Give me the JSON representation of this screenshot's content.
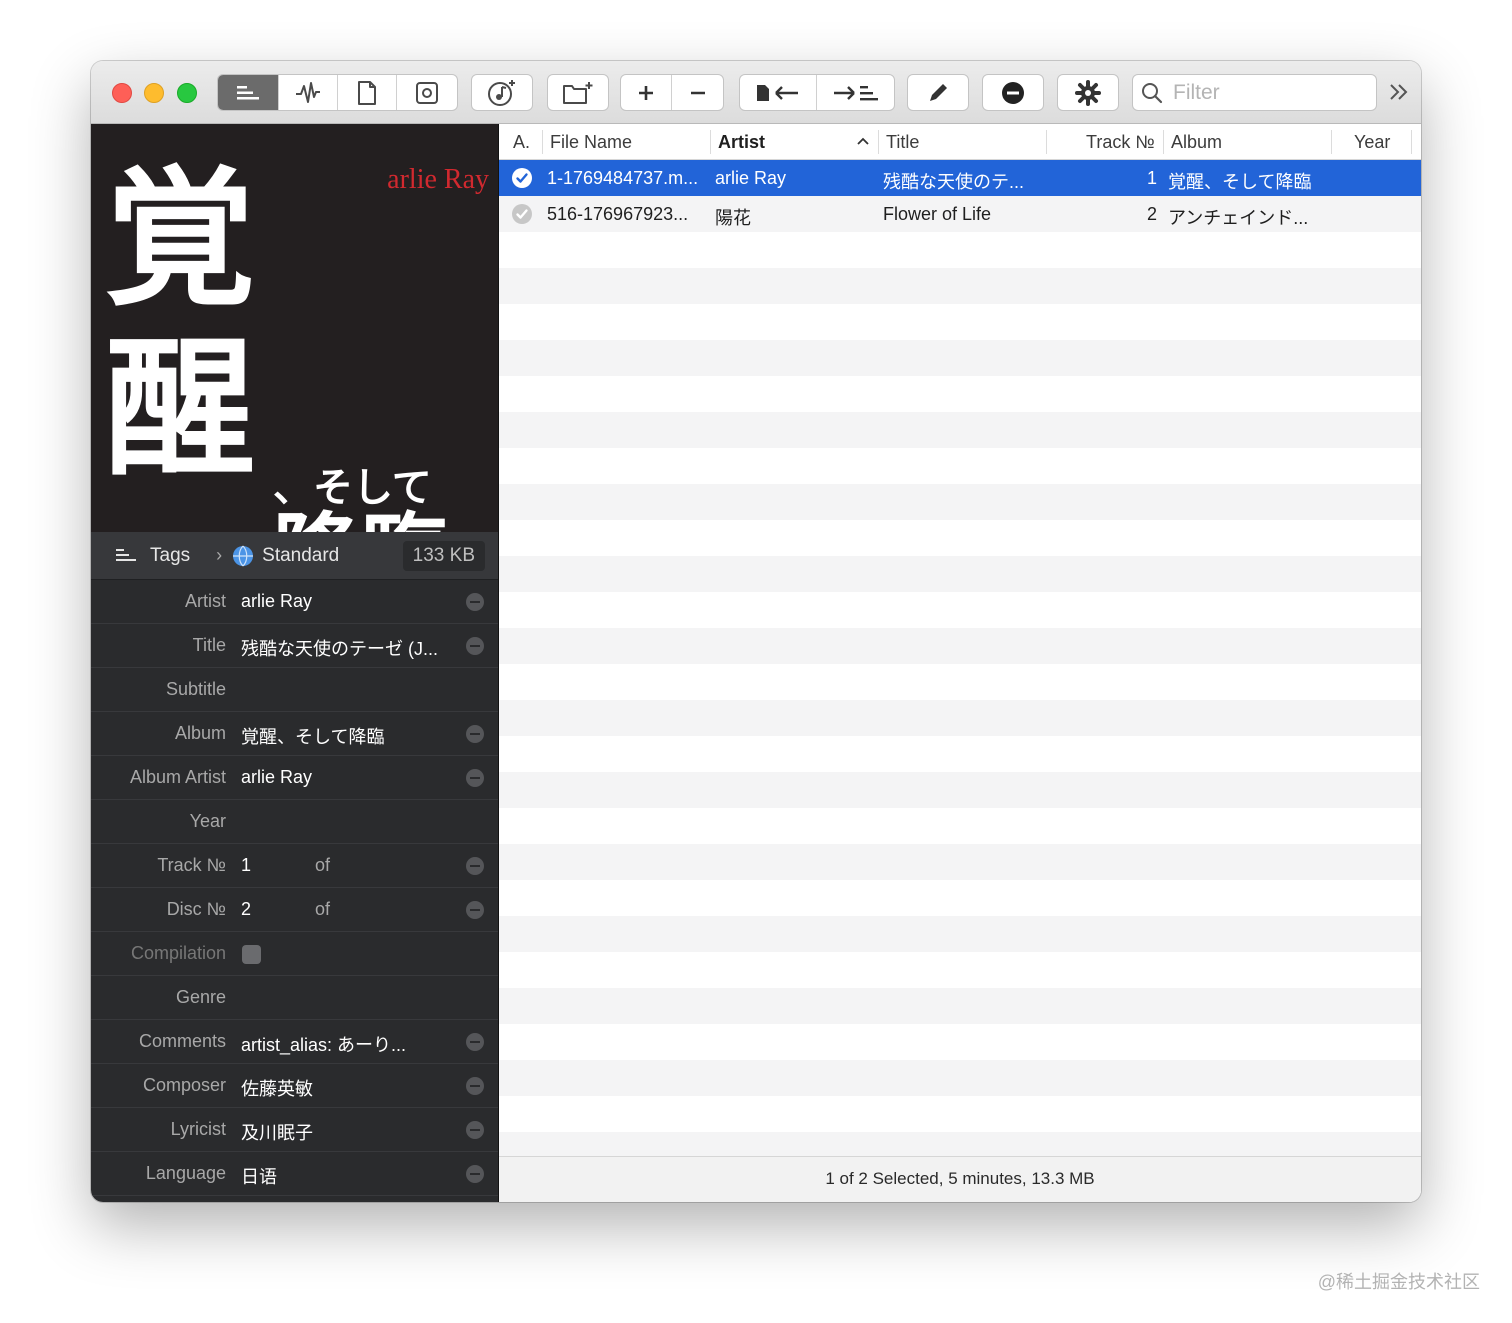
{
  "toolbar": {
    "filter_placeholder": "Filter"
  },
  "artwork": {
    "artist_text": "arlie Ray",
    "kanji_1": "覚",
    "kanji_2": "醒",
    "kana": "、そして",
    "kanji_3": "降臨"
  },
  "tags_bar": {
    "tags_label": "Tags",
    "mode_label": "Standard",
    "size": "133 KB"
  },
  "fields": [
    {
      "label": "Artist",
      "value": "arlie Ray"
    },
    {
      "label": "Title",
      "value": "残酷な天使のテーゼ (J..."
    },
    {
      "label": "Subtitle",
      "value": ""
    },
    {
      "label": "Album",
      "value": "覚醒、そして降臨"
    },
    {
      "label": "Album Artist",
      "value": "arlie Ray"
    },
    {
      "label": "Year",
      "value": ""
    },
    {
      "label": "Track №",
      "value": "1",
      "of": "of"
    },
    {
      "label": "Disc №",
      "value": "2",
      "of": "of"
    },
    {
      "label": "Compilation",
      "value": ""
    },
    {
      "label": "Genre",
      "value": ""
    },
    {
      "label": "Comments",
      "value": "artist_alias: あーり..."
    },
    {
      "label": "Composer",
      "value": "佐藤英敏"
    },
    {
      "label": "Lyricist",
      "value": "及川眠子"
    },
    {
      "label": "Language",
      "value": "日语"
    }
  ],
  "table": {
    "columns": {
      "a": "A.",
      "file_name": "File Name",
      "artist": "Artist",
      "title": "Title",
      "track": "Track №",
      "album": "Album",
      "year": "Year"
    },
    "rows": [
      {
        "file_name": "1-1769484737.m...",
        "artist": "arlie Ray",
        "title": "残酷な天使のテ...",
        "track": "1",
        "album": "覚醒、そして降臨",
        "year": ""
      },
      {
        "file_name": "516-176967923...",
        "artist": "陽花",
        "title": "Flower of Life",
        "track": "2",
        "album": "アンチェインド...",
        "year": ""
      }
    ]
  },
  "status": "1 of 2 Selected, 5 minutes, 13.3 MB",
  "watermark": "@稀土掘金技术社区",
  "colors": {
    "selection": "#2264d8",
    "close": "#fe5f57",
    "minimize": "#febc2e",
    "zoom": "#28c840",
    "artwork_red": "#d1292f"
  }
}
